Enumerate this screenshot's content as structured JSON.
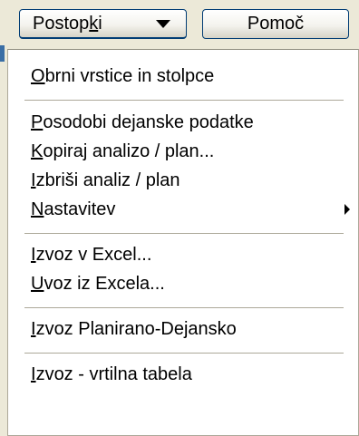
{
  "toolbar": {
    "actions_button": {
      "label_pre": "Postop",
      "label_mnemonic": "k",
      "label_post": "i"
    },
    "help_button": {
      "label": "Pomoč"
    }
  },
  "menu": {
    "items": [
      {
        "pre": "",
        "mnemonic": "O",
        "post": "brni vrstice in stolpce",
        "submenu": false
      },
      {
        "pre": "",
        "mnemonic": "P",
        "post": "osodobi dejanske podatke",
        "submenu": false
      },
      {
        "pre": "",
        "mnemonic": "K",
        "post": "opiraj analizo / plan...",
        "submenu": false
      },
      {
        "pre": "",
        "mnemonic": "I",
        "post": "zbriši analiz / plan",
        "submenu": false
      },
      {
        "pre": "",
        "mnemonic": "N",
        "post": "astavitev",
        "submenu": true
      },
      {
        "pre": "",
        "mnemonic": "I",
        "post": "zvoz v Excel...",
        "submenu": false
      },
      {
        "pre": "",
        "mnemonic": "U",
        "post": "voz iz Excela...",
        "submenu": false
      },
      {
        "pre": "",
        "mnemonic": "I",
        "post": "zvoz Planirano-Dejansko",
        "submenu": false
      },
      {
        "pre": "",
        "mnemonic": "I",
        "post": "zvoz - vrtilna tabela",
        "submenu": false
      }
    ]
  },
  "icons": {
    "dropdown_caret": "caret-down-icon",
    "submenu_arrow": "caret-right-icon"
  }
}
